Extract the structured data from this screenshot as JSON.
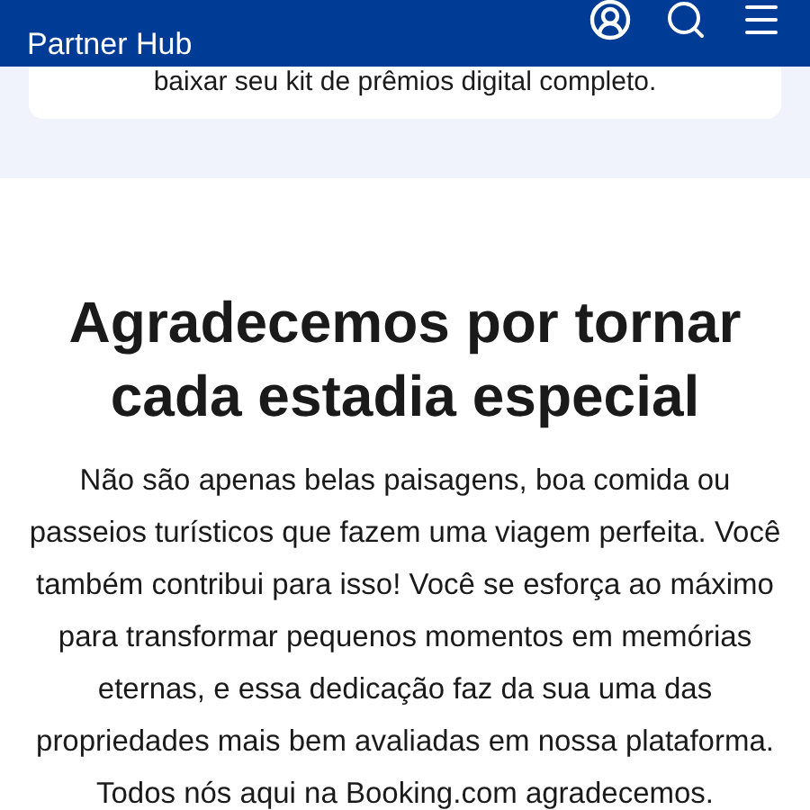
{
  "header": {
    "subtitle": "Partner Hub"
  },
  "card": {
    "text": "baixar seu kit de prêmios digital completo."
  },
  "section": {
    "heading": "Agradecemos por tornar cada estadia especial",
    "body": "Não são apenas belas paisagens, boa comida ou passeios turísticos que fazem uma viagem perfeita. Você também contribui para isso! Você se esforça ao máximo para transformar pequenos momentos em memórias eternas, e essa dedicação faz da sua uma das propriedades mais bem avaliadas em nossa plataforma. Todos nós aqui na Booking.com agradecemos."
  }
}
